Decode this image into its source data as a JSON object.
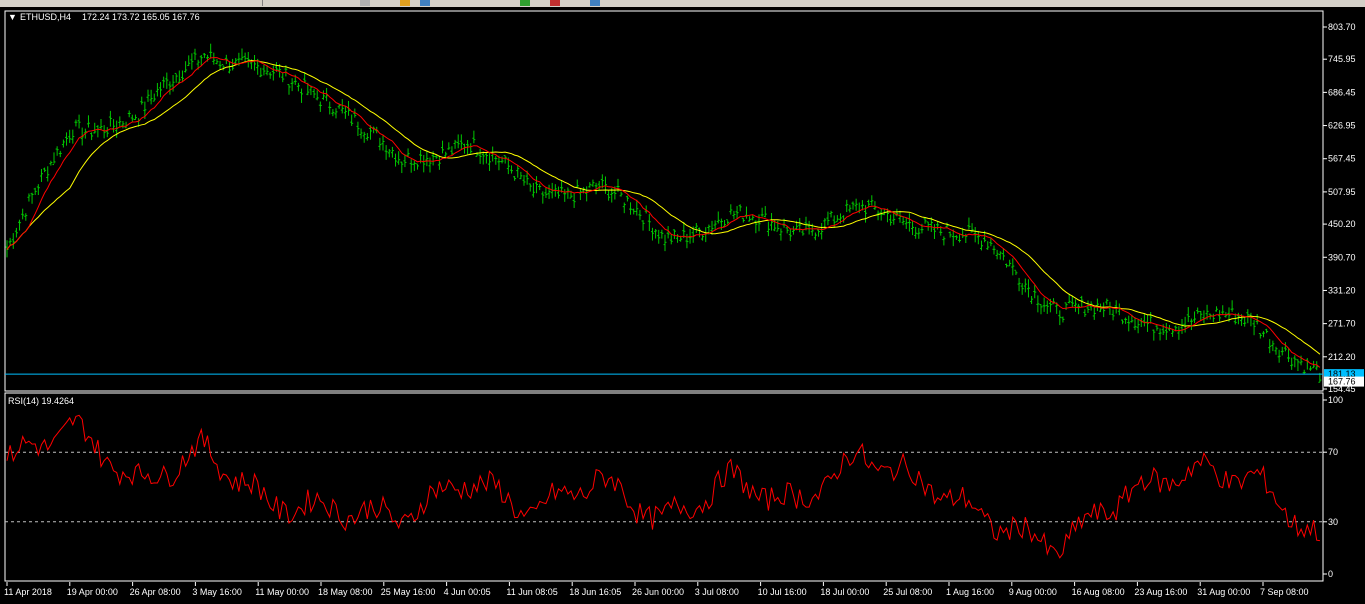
{
  "main_chart": {
    "symbol_label": "ETHUSD,H4",
    "ohlc_label": "172.24 173.72 165.05 167.76",
    "price_ticks": [
      "803.70",
      "745.95",
      "686.45",
      "626.95",
      "567.45",
      "507.95",
      "450.20",
      "390.70",
      "331.20",
      "271.70",
      "212.20",
      "154.45"
    ],
    "current_price_tag": "181.13",
    "last_price_tag": "167.76",
    "colors": {
      "bars": "#00c800",
      "ma_fast": "#ff0000",
      "ma_slow": "#ffff00",
      "hline": "#00bfff",
      "rsi": "#ff0000"
    }
  },
  "rsi_panel": {
    "label": "RSI(14) 19.4264",
    "level_ticks": [
      "100",
      "70",
      "30",
      "0"
    ]
  },
  "x_axis": {
    "labels": [
      "11 Apr 2018",
      "19 Apr 00:00",
      "26 Apr 08:00",
      "3 May 16:00",
      "11 May 00:00",
      "18 May 08:00",
      "25 May 16:00",
      "4 Jun 00:05",
      "11 Jun 08:05",
      "18 Jun 16:05",
      "26 Jun 00:00",
      "3 Jul 08:00",
      "10 Jul 16:00",
      "18 Jul 00:00",
      "25 Jul 08:00",
      "1 Aug 16:00",
      "9 Aug 00:00",
      "16 Aug 08:00",
      "23 Aug 16:00",
      "31 Aug 00:00",
      "7 Sep 08:00"
    ]
  },
  "chart_data": [
    {
      "type": "line",
      "title": "ETHUSD,H4",
      "x": [
        "11 Apr 2018",
        "19 Apr 00:00",
        "26 Apr 08:00",
        "3 May 16:00",
        "11 May 00:00",
        "18 May 08:00",
        "25 May 16:00",
        "4 Jun 00:05",
        "11 Jun 08:05",
        "18 Jun 16:05",
        "26 Jun 00:00",
        "3 Jul 08:00",
        "10 Jul 16:00",
        "18 Jul 00:00",
        "25 Jul 08:00",
        "1 Aug 16:00",
        "9 Aug 00:00",
        "16 Aug 08:00",
        "23 Aug 16:00",
        "31 Aug 00:00",
        "7 Sep 08:00"
      ],
      "series": [
        {
          "values": [
            405,
            625,
            640,
            765,
            715,
            675,
            555,
            605,
            505,
            520,
            430,
            460,
            445,
            470,
            455,
            405,
            300,
            285,
            275,
            280,
            175
          ]
        }
      ],
      "ylim": [
        154.45,
        803.7
      ],
      "horizontal_line": 181.13
    },
    {
      "type": "line",
      "title": "RSI(14) 19.4264",
      "x": [
        "11 Apr 2018",
        "19 Apr 00:00",
        "26 Apr 08:00",
        "3 May 16:00",
        "11 May 00:00",
        "18 May 08:00",
        "25 May 16:00",
        "4 Jun 00:05",
        "11 Jun 08:05",
        "18 Jun 16:05",
        "26 Jun 00:00",
        "3 Jul 08:00",
        "10 Jul 16:00",
        "18 Jul 00:00",
        "25 Jul 08:00",
        "1 Aug 16:00",
        "9 Aug 00:00",
        "16 Aug 08:00",
        "23 Aug 16:00",
        "31 Aug 00:00",
        "7 Sep 08:00"
      ],
      "series": [
        {
          "values": [
            65,
            85,
            52,
            72,
            40,
            38,
            32,
            55,
            35,
            55,
            30,
            55,
            40,
            68,
            52,
            30,
            15,
            45,
            60,
            55,
            19
          ]
        }
      ],
      "ylim": [
        0,
        100
      ],
      "levels": [
        70,
        30
      ]
    }
  ]
}
